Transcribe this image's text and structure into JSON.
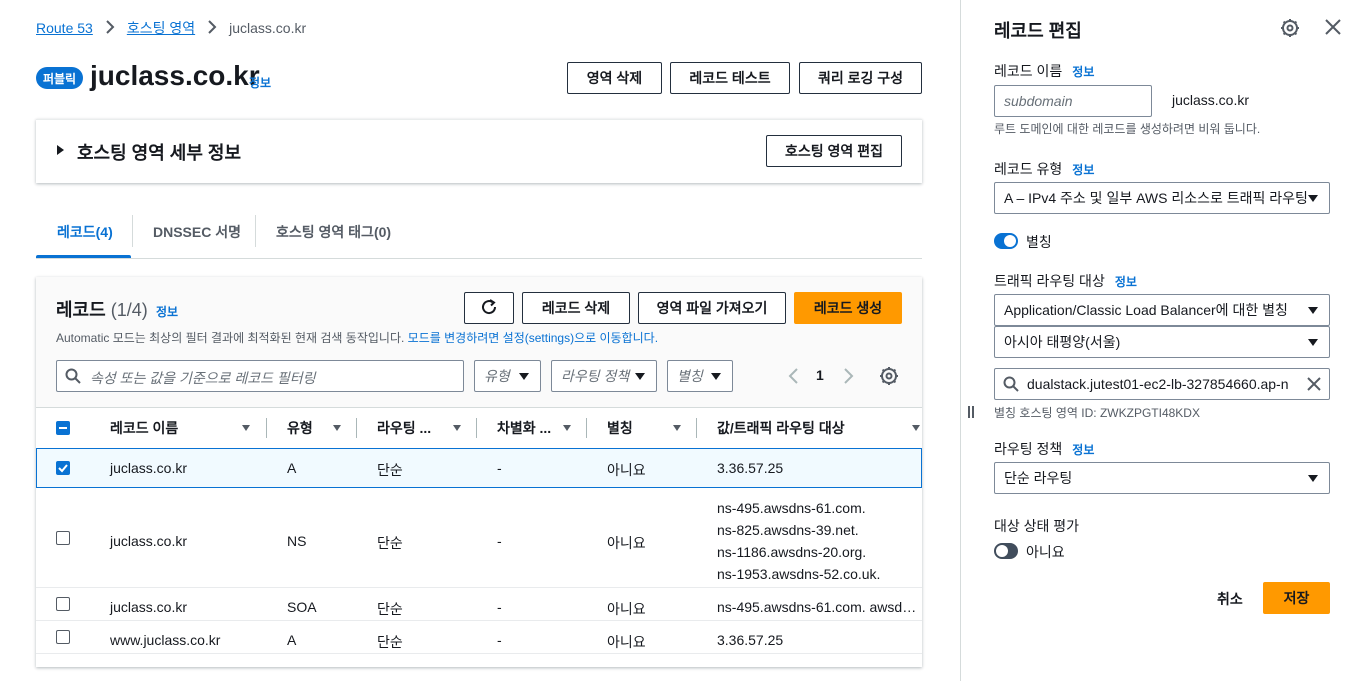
{
  "breadcrumb": {
    "items": [
      "Route 53",
      "호스팅 영역",
      "juclass.co.kr"
    ]
  },
  "header": {
    "badge": "퍼블릭",
    "title": "juclass.co.kr",
    "info": "정보",
    "buttons": {
      "delete_zone": "영역 삭제",
      "test_record": "레코드 테스트",
      "query_logging": "쿼리 로깅 구성"
    }
  },
  "details": {
    "label": "호스팅 영역 세부 정보",
    "edit_button": "호스팅 영역 편집"
  },
  "tabs": [
    {
      "label": "레코드(4)",
      "active": true
    },
    {
      "label": "DNSSEC 서명",
      "active": false
    },
    {
      "label": "호스팅 영역 태그(0)",
      "active": false
    }
  ],
  "records": {
    "title": "레코드",
    "count": "(1/4)",
    "info": "정보",
    "subtitle": "Automatic 모드는 최상의 필터 결과에 최적화된 현재 검색 동작입니다.",
    "subtitle_link": "모드를 변경하려면 설정(settings)으로 이동합니다.",
    "buttons": {
      "delete": "레코드 삭제",
      "import": "영역 파일 가져오기",
      "create": "레코드 생성"
    },
    "search_placeholder": "속성 또는 값을 기준으로 레코드 필터링",
    "filters": {
      "type": "유형",
      "routing": "라우팅 정책",
      "alias": "별칭"
    },
    "page": "1",
    "columns": [
      "레코드 이름",
      "유형",
      "라우팅 ...",
      "차별화 ...",
      "별칭",
      "값/트래픽 라우팅 대상"
    ],
    "rows": [
      {
        "selected": true,
        "name": "juclass.co.kr",
        "type": "A",
        "routing": "단순",
        "diff": "-",
        "alias": "아니요",
        "values": [
          "3.36.57.25"
        ]
      },
      {
        "selected": false,
        "name": "juclass.co.kr",
        "type": "NS",
        "routing": "단순",
        "diff": "-",
        "alias": "아니요",
        "values": [
          "ns-495.awsdns-61.com.",
          "ns-825.awsdns-39.net.",
          "ns-1186.awsdns-20.org.",
          "ns-1953.awsdns-52.co.uk."
        ]
      },
      {
        "selected": false,
        "name": "juclass.co.kr",
        "type": "SOA",
        "routing": "단순",
        "diff": "-",
        "alias": "아니요",
        "values": [
          "ns-495.awsdns-61.com. awsd…"
        ]
      },
      {
        "selected": false,
        "name": "www.juclass.co.kr",
        "type": "A",
        "routing": "단순",
        "diff": "-",
        "alias": "아니요",
        "values": [
          "3.36.57.25"
        ]
      }
    ]
  },
  "panel": {
    "title": "레코드 편집",
    "record_name_label": "레코드 이름",
    "info": "정보",
    "subdomain_placeholder": "subdomain",
    "domain_suffix": "juclass.co.kr",
    "record_name_hint": "루트 도메인에 대한 레코드를 생성하려면 비워 둡니다.",
    "record_type_label": "레코드 유형",
    "record_type_value": "A – IPv4 주소 및 일부 AWS 리소스로 트래픽 라우팅",
    "alias_label": "별칭",
    "alias_on": true,
    "target_label": "트래픽 라우팅 대상",
    "target_type": "Application/Classic Load Balancer에 대한 별칭",
    "target_region": "아시아 태평양(서울)",
    "target_value": "dualstack.jutest01-ec2-lb-327854660.ap-n",
    "alias_zone_hint": "별칭 호스팅 영역 ID: ZWKZPGTI48KDX",
    "routing_label": "라우팅 정책",
    "routing_value": "단순 라우팅",
    "health_label": "대상 상태 평가",
    "health_value": "아니요",
    "health_on": false,
    "cancel": "취소",
    "save": "저장"
  },
  "colors": {
    "primary": "#ff9900",
    "link": "#0972d3",
    "badge": "#0972d3",
    "toggle_on": "#0972d3",
    "toggle_off": "#414d5c"
  }
}
